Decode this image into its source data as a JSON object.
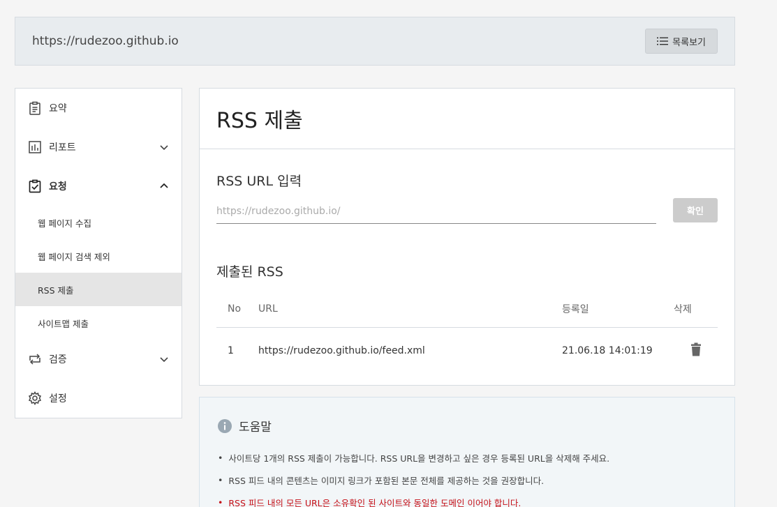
{
  "topbar": {
    "site_url": "https://rudezoo.github.io",
    "list_button_label": "목록보기"
  },
  "sidebar": {
    "items": [
      {
        "label": "요약",
        "icon": "clipboard-icon"
      },
      {
        "label": "리포트",
        "icon": "bar-chart-icon",
        "chevron": "down"
      },
      {
        "label": "요청",
        "icon": "clipboard-check-icon",
        "chevron": "up",
        "expanded": true
      },
      {
        "label": "검증",
        "icon": "swap-arrows-icon",
        "chevron": "down"
      },
      {
        "label": "설정",
        "icon": "gear-icon"
      }
    ],
    "subitems": [
      {
        "label": "웹 페이지 수집"
      },
      {
        "label": "웹 페이지 검색 제외"
      },
      {
        "label": "RSS 제출",
        "active": true
      },
      {
        "label": "사이트맵 제출"
      }
    ]
  },
  "panel": {
    "title": "RSS 제출",
    "input_section_label": "RSS URL 입력",
    "input_placeholder": "https://rudezoo.github.io/",
    "input_value": "",
    "confirm_label": "확인",
    "submitted_label": "제출된 RSS",
    "table": {
      "headers": [
        "No",
        "URL",
        "등록일",
        "삭제"
      ],
      "rows": [
        {
          "no": "1",
          "url": "https://rudezoo.github.io/feed.xml",
          "date": "21.06.18 14:01:19"
        }
      ]
    }
  },
  "help": {
    "title": "도움말",
    "items": [
      "사이트당 1개의 RSS 제출이 가능합니다. RSS URL을 변경하고 싶은 경우 등록된 URL을 삭제해 주세요.",
      "RSS 피드 내의 콘텐츠는 이미지 링크가 포함된 본문 전체를 제공하는 것을 권장합니다.",
      "RSS 피드 내의 모든 URL은 소유확인 된 사이트와 동일한 도메인 이어야 합니다."
    ]
  },
  "colors": {
    "page_bg": "#f5f5f5",
    "topbar_bg": "#e8ecef",
    "active_item_bg": "#e5e5e5",
    "button_disabled": "#cccccc",
    "help_bg": "#f2f6f8",
    "warning_text": "#c51018"
  }
}
